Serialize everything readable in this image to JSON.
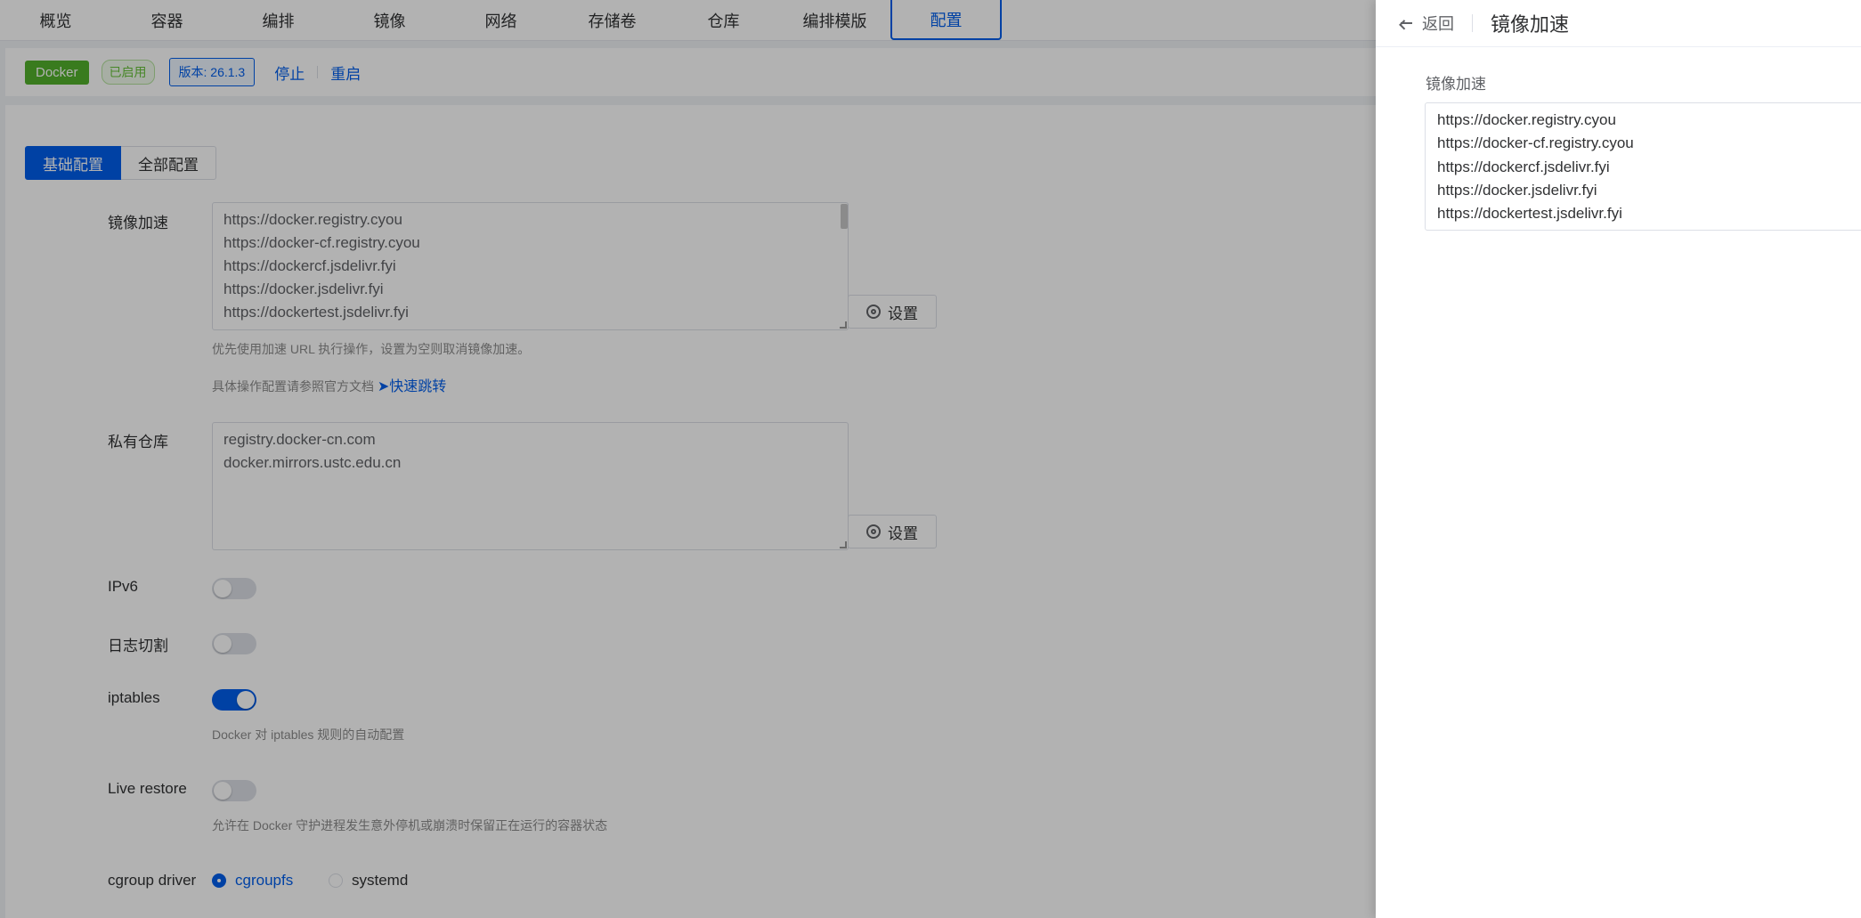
{
  "topnav": {
    "tabs": [
      {
        "label": "概览",
        "active": false
      },
      {
        "label": "容器",
        "active": false
      },
      {
        "label": "编排",
        "active": false
      },
      {
        "label": "镜像",
        "active": false
      },
      {
        "label": "网络",
        "active": false
      },
      {
        "label": "存储卷",
        "active": false
      },
      {
        "label": "仓库",
        "active": false
      },
      {
        "label": "编排模版",
        "active": false
      },
      {
        "label": "配置",
        "active": true
      }
    ]
  },
  "status": {
    "name": "Docker",
    "state": "已启用",
    "version": "版本: 26.1.3",
    "stop": "停止",
    "restart": "重启"
  },
  "segments": {
    "basic": "基础配置",
    "all": "全部配置"
  },
  "form": {
    "mirror": {
      "label": "镜像加速",
      "lines": [
        "https://docker.registry.cyou",
        "https://docker-cf.registry.cyou",
        "https://dockercf.jsdelivr.fyi",
        "https://docker.jsdelivr.fyi",
        "https://dockertest.jsdelivr.fyi"
      ],
      "set_button": "设置",
      "help": "优先使用加速 URL 执行操作，设置为空则取消镜像加速。",
      "doc_hint": "具体操作配置请参照官方文档",
      "jump": "快速跳转"
    },
    "private_repo": {
      "label": "私有仓库",
      "lines": [
        "registry.docker-cn.com",
        "docker.mirrors.ustc.edu.cn"
      ],
      "set_button": "设置"
    },
    "ipv6": {
      "label": "IPv6",
      "on": false
    },
    "log_rotate": {
      "label": "日志切割",
      "on": false
    },
    "iptables": {
      "label": "iptables",
      "on": true,
      "help": "Docker 对 iptables 规则的自动配置"
    },
    "live_restore": {
      "label": "Live restore",
      "on": false,
      "help": "允许在 Docker 守护进程发生意外停机或崩溃时保留正在运行的容器状态"
    },
    "cgroup": {
      "label": "cgroup driver",
      "options": [
        "cgroupfs",
        "systemd"
      ],
      "selected": "cgroupfs"
    }
  },
  "drawer": {
    "back": "返回",
    "title": "镜像加速",
    "field_label": "镜像加速",
    "lines": [
      "https://docker.registry.cyou",
      "https://docker-cf.registry.cyou",
      "https://dockercf.jsdelivr.fyi",
      "https://docker.jsdelivr.fyi",
      "https://dockertest.jsdelivr.fyi"
    ]
  },
  "colors": {
    "primary": "#005eeb",
    "success": "#52b12c",
    "overlay": "rgba(0,0,0,0.30)"
  }
}
